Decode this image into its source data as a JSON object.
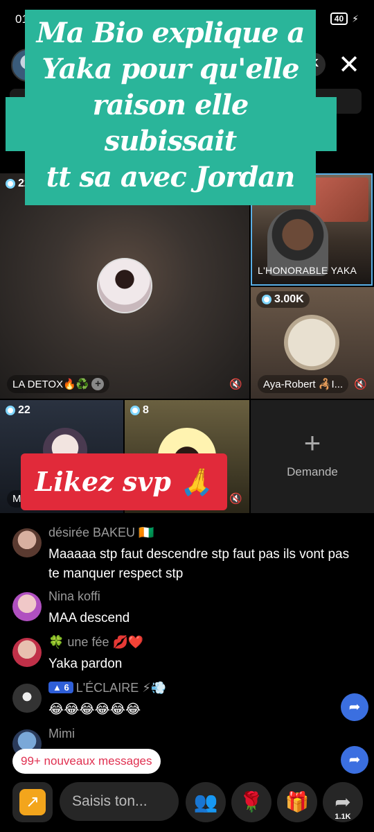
{
  "status_bar": {
    "time": "01",
    "battery": "40"
  },
  "overlay_title": {
    "line1": "Ma Bio explique a",
    "line2": "Yaka pour qu'elle",
    "line3": "raison elle subissait",
    "line4": "tt sa avec Jordan"
  },
  "top_pill_text": "K",
  "tiles": {
    "main": {
      "viewers": "22",
      "label": "LA DETOX🔥♻️"
    },
    "yaka": {
      "label": "L'HONORABLE YAKA"
    },
    "aya": {
      "viewers": "3.00K",
      "label": "Aya-Robert 🦂I..."
    },
    "b1": {
      "viewers": "22",
      "label": "M"
    },
    "b2": {
      "viewers": "8"
    },
    "request": {
      "label": "Demande",
      "plus": "+"
    }
  },
  "likez": "Likez svp 🙏",
  "comments": [
    {
      "name": "désirée BAKEU 🇨🇮",
      "text": "Maaaaa stp faut descendre stp faut pas ils vont pas te manquer respect stp"
    },
    {
      "name": "Nina koffi",
      "text": "MAA descend"
    },
    {
      "name": "🍀 une fée 💋❤️",
      "text": "Yaka pardon"
    },
    {
      "rank": "6",
      "name": "L'ÉCLAIRE ⚡💨",
      "text": "😂😂😂😂😂😂"
    },
    {
      "name": "Mimi",
      "text": "M"
    }
  ],
  "new_messages": "99+ nouveaux messages",
  "bottom_bar": {
    "input_placeholder": "Saisis ton...",
    "forward_count": "1.1K"
  },
  "icons": {
    "share": "share-arrow-icon",
    "users": "users-icon",
    "rose": "rose-icon",
    "gift": "gift-icon",
    "forward": "forward-icon",
    "close": "close-icon",
    "mic_off": "mic-off-icon"
  },
  "colors": {
    "overlay_teal": "#2ab59a",
    "likez_red": "#e12a3a",
    "share_orange": "#f3a51c",
    "fab_blue": "#3b6fe0"
  }
}
